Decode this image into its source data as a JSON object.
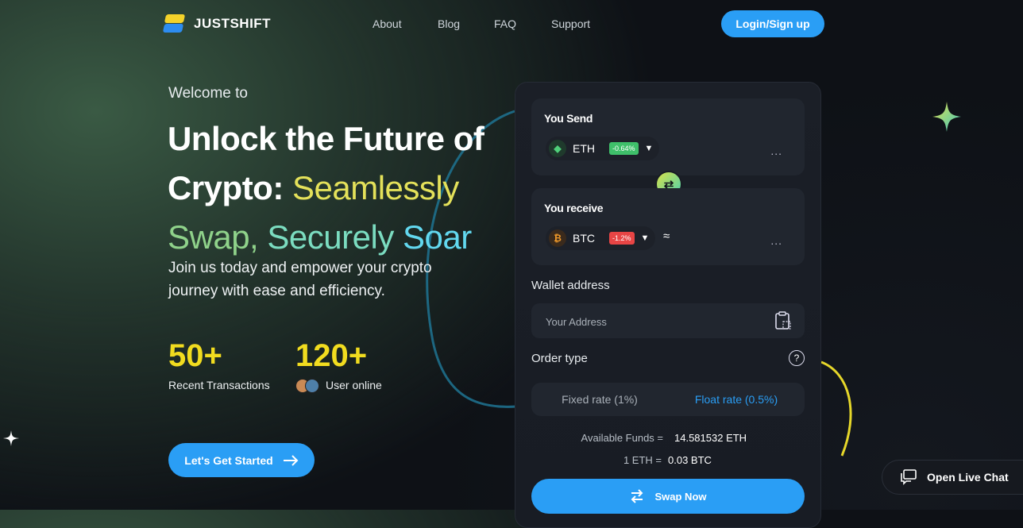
{
  "header": {
    "brand": "JUSTSHIFT",
    "nav": [
      "About",
      "Blog",
      "FAQ",
      "Support"
    ],
    "login_label": "Login/Sign up"
  },
  "hero": {
    "welcome": "Welcome to",
    "headline_1": "Unlock the Future of Crypto: ",
    "headline_2": "Seamlessly",
    "headline_3": "Swap,",
    "headline_4": "Securely",
    "headline_5": "Soar",
    "subtext": "Join us today and empower your crypto journey with ease and efficiency.",
    "stats": [
      {
        "value": "50+",
        "label": "Recent Transactions"
      },
      {
        "value": "120+",
        "label": "User online"
      }
    ],
    "cta_label": "Let's Get Started"
  },
  "swap": {
    "send_title": "You Send",
    "send_coin": "ETH",
    "send_change": "-0.64%",
    "send_change_color": "#3fbf6a",
    "send_amount": "...",
    "receive_title": "You receive",
    "receive_coin": "BTC",
    "receive_change": "-1.2%",
    "receive_change_color": "#e84545",
    "approx": "≈",
    "receive_amount": "...",
    "wallet_label": "Wallet address",
    "wallet_placeholder": "Your Address",
    "order_type_label": "Order type",
    "help": "?",
    "fixed_rate": "Fixed rate (1%)",
    "float_rate": "Float rate (0.5%)",
    "available_label": "Available Funds =",
    "available_value": "14.581532 ETH",
    "rate_label": "1 ETH =",
    "rate_value": "0.03 BTC",
    "swap_label": "Swap Now"
  },
  "live_chat_label": "Open Live Chat",
  "colors": {
    "accent": "#2a9ef5",
    "stat_yellow": "#f1dc1f"
  }
}
